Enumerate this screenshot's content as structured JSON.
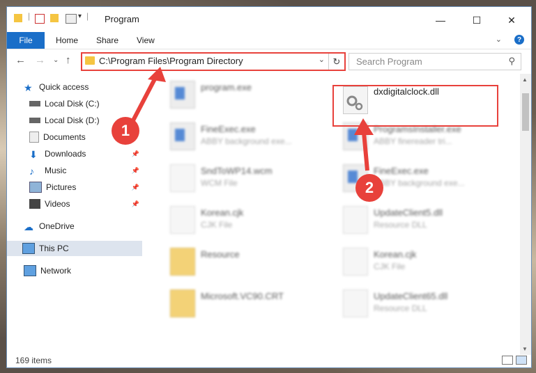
{
  "window": {
    "title": "Program"
  },
  "ribbon": {
    "file": "File",
    "tabs": [
      "Home",
      "Share",
      "View"
    ],
    "help": "?"
  },
  "address": {
    "path": "C:\\Program Files\\Program Directory"
  },
  "search": {
    "placeholder": "Search Program"
  },
  "sidebar": {
    "quick_access": "Quick access",
    "items": [
      "Local Disk (C:)",
      "Local Disk (D:)",
      "Documents",
      "Downloads",
      "Music",
      "Pictures",
      "Videos"
    ],
    "onedrive": "OneDrive",
    "this_pc": "This PC",
    "network": "Network"
  },
  "files": {
    "left": [
      {
        "name": "program.exe",
        "sub": ""
      },
      {
        "name": "FineExec.exe",
        "sub": "ABBY background exe..."
      },
      {
        "name": "SndToWP14.wcm",
        "sub": "WCM File"
      },
      {
        "name": "Korean.cjk",
        "sub": "CJK File"
      },
      {
        "name": "Resource",
        "sub": ""
      },
      {
        "name": "Microsoft.VC90.CRT",
        "sub": ""
      }
    ],
    "right": [
      {
        "name": "dxdigitalclock.dll",
        "sub": ""
      },
      {
        "name": "ProgramsInstaller.exe",
        "sub": "ABBY finereader tri..."
      },
      {
        "name": "FineExec.exe",
        "sub": "ABBY background exe..."
      },
      {
        "name": "UpdateClient5.dll",
        "sub": "Resource DLL"
      },
      {
        "name": "Korean.cjk",
        "sub": "CJK File"
      },
      {
        "name": "UpdateClient65.dll",
        "sub": "Resource DLL"
      }
    ]
  },
  "status": {
    "count": "169 items"
  },
  "annotations": {
    "badge1": "1",
    "badge2": "2",
    "accent": "#e8413b"
  }
}
